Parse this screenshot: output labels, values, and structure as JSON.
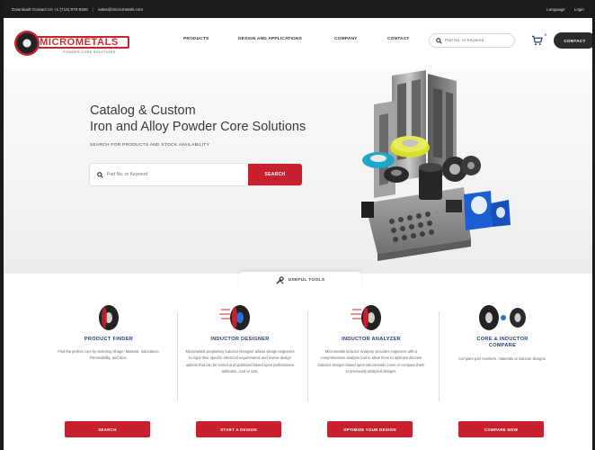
{
  "topbar": {
    "download": "Download! Contact Us +1 (714) 970-9400",
    "separator": "|",
    "email": "sales@micrometals.com",
    "language": "Language",
    "login": "Login"
  },
  "logo": {
    "name": "MICROMETALS",
    "tagline": "POWDER CORE SOLUTIONS"
  },
  "nav": {
    "items": [
      "PRODUCTS",
      "DESIGN AND APPLICATIONS",
      "COMPANY",
      "CONTACT"
    ]
  },
  "header_search": {
    "placeholder": "Part No. or Keyword"
  },
  "cart": {
    "count": "0"
  },
  "contact_button": "CONTACT",
  "hero": {
    "title_line1": "Catalog & Custom",
    "title_line2": "Iron and Alloy Powder Core Solutions",
    "subtitle": "SEARCH FOR PRODUCTS AND STOCK AVAILABILITY",
    "search_placeholder": "Part No. or Keyword",
    "search_button": "SEARCH"
  },
  "tools_tab": "USEFUL TOOLS",
  "tools": [
    {
      "title": "PRODUCT FINDER",
      "description": "Find the perfect core by selecting Shape, Material, Inductance, Permeability, and Size.",
      "button": "SEARCH"
    },
    {
      "title": "INDUCTOR DESIGNER",
      "description": "Micrometals proprietary Inductor Designer allows design engineers to input their specific electrical requirements and review design options that can be sorted and optimized based upon performance attributes, cost or size.",
      "button": "START A DESIGN"
    },
    {
      "title": "INDUCTOR ANALYZER",
      "description": "Micrometals Inductor Analyzer provides engineers with a comprehensive analysis tool to allow them to optimize discrete inductor designs based upon Micrometals cores or compare them to previously analyzed designs.",
      "button": "OPTIMIZE YOUR DESIGN"
    },
    {
      "title_line1": "CORE & INDUCTOR",
      "title_line2": "COMPARE",
      "description": "Compare part numbers, materials or inductor designs.",
      "button": "COMPARE NOW"
    }
  ],
  "colors": {
    "brand_red": "#c8202f",
    "nav_dark": "#1c1c1c",
    "tool_title_blue": "#2c3e72"
  }
}
